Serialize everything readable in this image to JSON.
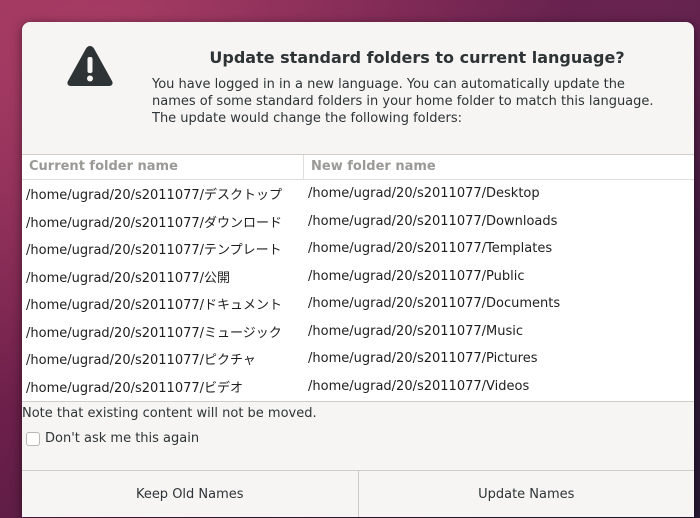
{
  "dialog": {
    "title": "Update standard folders to current language?",
    "description": "You have logged in in a new language. You can automatically update the names of some standard folders in your home folder to match this language. The update would change the following folders:",
    "table": {
      "headers": [
        "Current folder name",
        "New folder name"
      ],
      "rows": [
        [
          "/home/ugrad/20/s2011077/デスクトップ",
          "/home/ugrad/20/s2011077/Desktop"
        ],
        [
          "/home/ugrad/20/s2011077/ダウンロード",
          "/home/ugrad/20/s2011077/Downloads"
        ],
        [
          "/home/ugrad/20/s2011077/テンプレート",
          "/home/ugrad/20/s2011077/Templates"
        ],
        [
          "/home/ugrad/20/s2011077/公開",
          "/home/ugrad/20/s2011077/Public"
        ],
        [
          "/home/ugrad/20/s2011077/ドキュメント",
          "/home/ugrad/20/s2011077/Documents"
        ],
        [
          "/home/ugrad/20/s2011077/ミュージック",
          "/home/ugrad/20/s2011077/Music"
        ],
        [
          "/home/ugrad/20/s2011077/ピクチャ",
          "/home/ugrad/20/s2011077/Pictures"
        ],
        [
          "/home/ugrad/20/s2011077/ビデオ",
          "/home/ugrad/20/s2011077/Videos"
        ]
      ]
    },
    "note": "Note that existing content will not be moved.",
    "checkbox": {
      "label": "Don't ask me this again",
      "checked": false
    },
    "buttons": {
      "keep": "Keep Old Names",
      "update": "Update Names"
    },
    "icon": "warning-icon"
  },
  "colors": {
    "dialog_bg": "#f6f5f4",
    "text": "#2e3436",
    "header_text": "#9a9996"
  }
}
